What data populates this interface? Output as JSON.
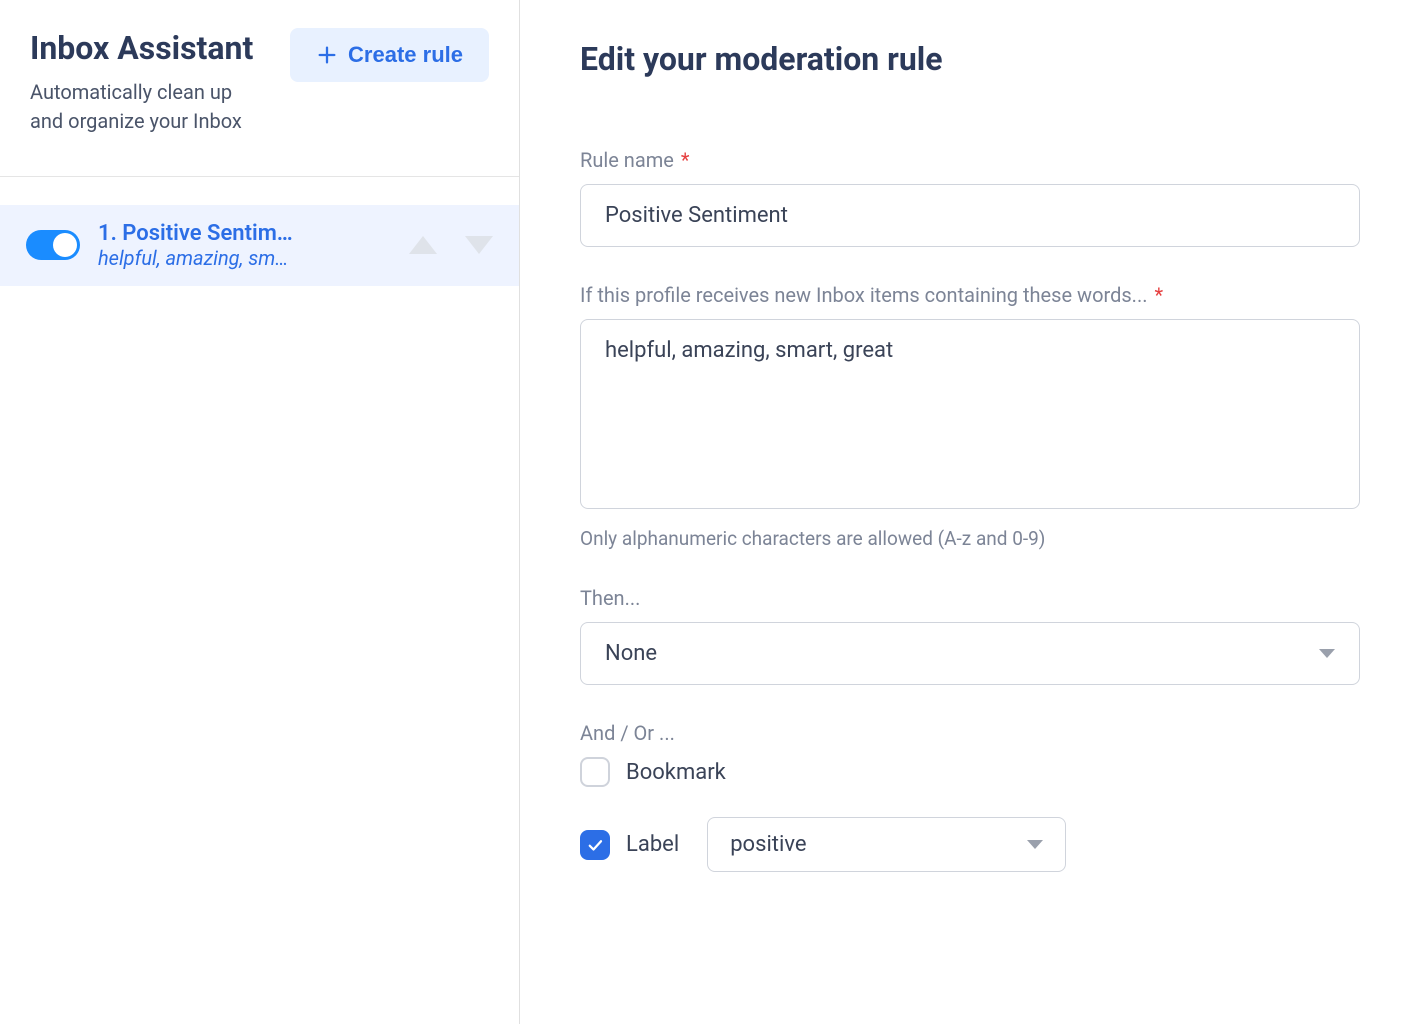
{
  "sidebar": {
    "title": "Inbox Assistant",
    "subtitle": "Automatically clean up and organize your Inbox",
    "create_rule_label": "Create rule",
    "rules": [
      {
        "title": "1. Positive Sentim…",
        "preview": "helpful, amazing, sm…",
        "enabled": true
      }
    ]
  },
  "main": {
    "title": "Edit your moderation rule",
    "rule_name_label": "Rule name",
    "rule_name_value": "Positive Sentiment",
    "words_label": "If this profile receives new Inbox items containing these words...",
    "words_value": "helpful, amazing, smart, great",
    "words_helper": "Only alphanumeric characters are allowed (A-z and 0-9)",
    "then_label": "Then...",
    "then_value": "None",
    "andor_label": "And / Or ...",
    "bookmark_label": "Bookmark",
    "label_label": "Label",
    "label_value": "positive"
  }
}
